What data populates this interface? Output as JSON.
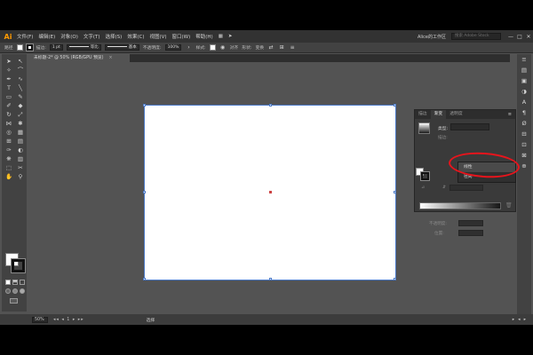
{
  "app": {
    "logo": "Ai",
    "menus": [
      "文件(F)",
      "编辑(E)",
      "对象(O)",
      "文字(T)",
      "选择(S)",
      "效果(C)",
      "视图(V)",
      "窗口(W)",
      "帮助(H)"
    ],
    "workspace": "Alice的工作区",
    "search_placeholder": "搜索 Adobe Stock",
    "window_buttons": [
      "—",
      "□",
      "✕"
    ]
  },
  "control_bar": {
    "path_label": "路径",
    "stroke_label": "描边:",
    "stroke_weight": "1 pt",
    "profile_label": "等比",
    "brush_label": "基本",
    "opacity_label": "不透明度:",
    "opacity_value": "100%",
    "style_label": "样式:",
    "align_label": "对齐",
    "shape_label": "形状:",
    "transform_label": "变换"
  },
  "document": {
    "tab_title": "未标题-2* @ 50% (RGB/GPU 预览)",
    "close": "×"
  },
  "gradient_panel": {
    "tabs": [
      "描边",
      "渐变",
      "透明度"
    ],
    "active_tab": 1,
    "menu_glyph": "≡",
    "type_label": "类型:",
    "stroke_label": "描边:",
    "options": [
      "线性",
      "径向"
    ],
    "selected_option": "线性",
    "opacity_label": "不透明度:",
    "location_label": "位置:"
  },
  "statusbar": {
    "zoom": "50%",
    "page_nav": "◂◂ ◂ 1 ▸ ▸▸",
    "mode": "选择"
  },
  "colors": {
    "annotation": "#e8141c",
    "selection": "#4c7ac7",
    "ai_orange": "#ff9a00"
  }
}
